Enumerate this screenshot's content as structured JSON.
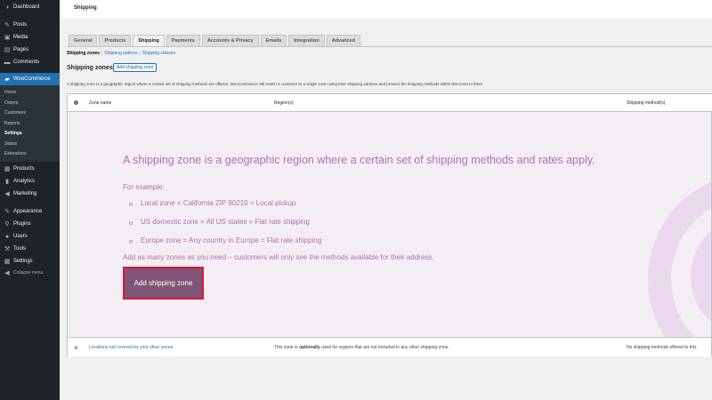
{
  "sidebar": {
    "items": [
      {
        "label": "Dashboard",
        "icon": "dashboard-icon",
        "glyph": "◑"
      },
      {
        "label": "Posts",
        "icon": "pin-icon",
        "glyph": "✎"
      },
      {
        "label": "Media",
        "icon": "media-icon",
        "glyph": "▣"
      },
      {
        "label": "Pages",
        "icon": "page-icon",
        "glyph": "▤"
      },
      {
        "label": "Comments",
        "icon": "comment-icon",
        "glyph": "▬"
      },
      {
        "label": "WooCommerce",
        "icon": "woo-icon",
        "glyph": "▰"
      },
      {
        "label": "Products",
        "icon": "products-icon",
        "glyph": "▦"
      },
      {
        "label": "Analytics",
        "icon": "analytics-icon",
        "glyph": "▮"
      },
      {
        "label": "Marketing",
        "icon": "megaphone-icon",
        "glyph": "◀"
      },
      {
        "label": "Appearance",
        "icon": "brush-icon",
        "glyph": "✎"
      },
      {
        "label": "Plugins",
        "icon": "plugin-icon",
        "glyph": "⚲"
      },
      {
        "label": "Users",
        "icon": "user-icon",
        "glyph": "●"
      },
      {
        "label": "Tools",
        "icon": "wrench-icon",
        "glyph": "⚒"
      },
      {
        "label": "Settings",
        "icon": "settings-icon",
        "glyph": "▩"
      },
      {
        "label": "Collapse menu",
        "icon": "collapse-icon",
        "glyph": "◀"
      }
    ],
    "submenu": [
      "Home",
      "Orders",
      "Customers",
      "Reports",
      "Settings",
      "Status",
      "Extensions"
    ],
    "active_color": "#2271b1"
  },
  "topbar": {
    "title": "Shipping"
  },
  "tabs": [
    "General",
    "Products",
    "Shipping",
    "Payments",
    "Accounts & Privacy",
    "Emails",
    "Integration",
    "Advanced"
  ],
  "active_tab": "Shipping",
  "subnav": {
    "current": "Shipping zones",
    "sep": "|",
    "options": "Shipping options",
    "classes": "Shipping classes"
  },
  "zones": {
    "title": "Shipping zones",
    "add_small": "Add shipping zone",
    "description": "A shipping zone is a geographic region where a certain set of shipping methods are offered. WooCommerce will match a customer to a single zone using their shipping address and present the shipping methods within that zone to them."
  },
  "table": {
    "headers": {
      "name": "Zone name",
      "regions": "Region(s)",
      "methods": "Shipping method(s)"
    },
    "blank": {
      "heading": "A shipping zone is a geographic region where a certain set of shipping methods and rates apply.",
      "for_example": "For example:",
      "examples": [
        "Local zone = California ZIP 90210 = Local pickup",
        "US domestic zone = All US states = Flat rate shipping",
        "Europe zone = Any country in Europe = Flat rate shipping"
      ],
      "closing": "Add as many zones as you need – customers will only see the methods available for their address.",
      "button": "Add shipping zone"
    },
    "footer": {
      "link": "Locations not covered by your other zones",
      "note_pre": "This zone is ",
      "note_bold": "optionally",
      "note_post": " used for regions that are not included in any other shipping zone.",
      "methods": "No shipping methods offered to this"
    }
  },
  "colors": {
    "accent": "#7f5477",
    "highlight_border": "#e0182d",
    "blank_text": "#b670a8"
  }
}
